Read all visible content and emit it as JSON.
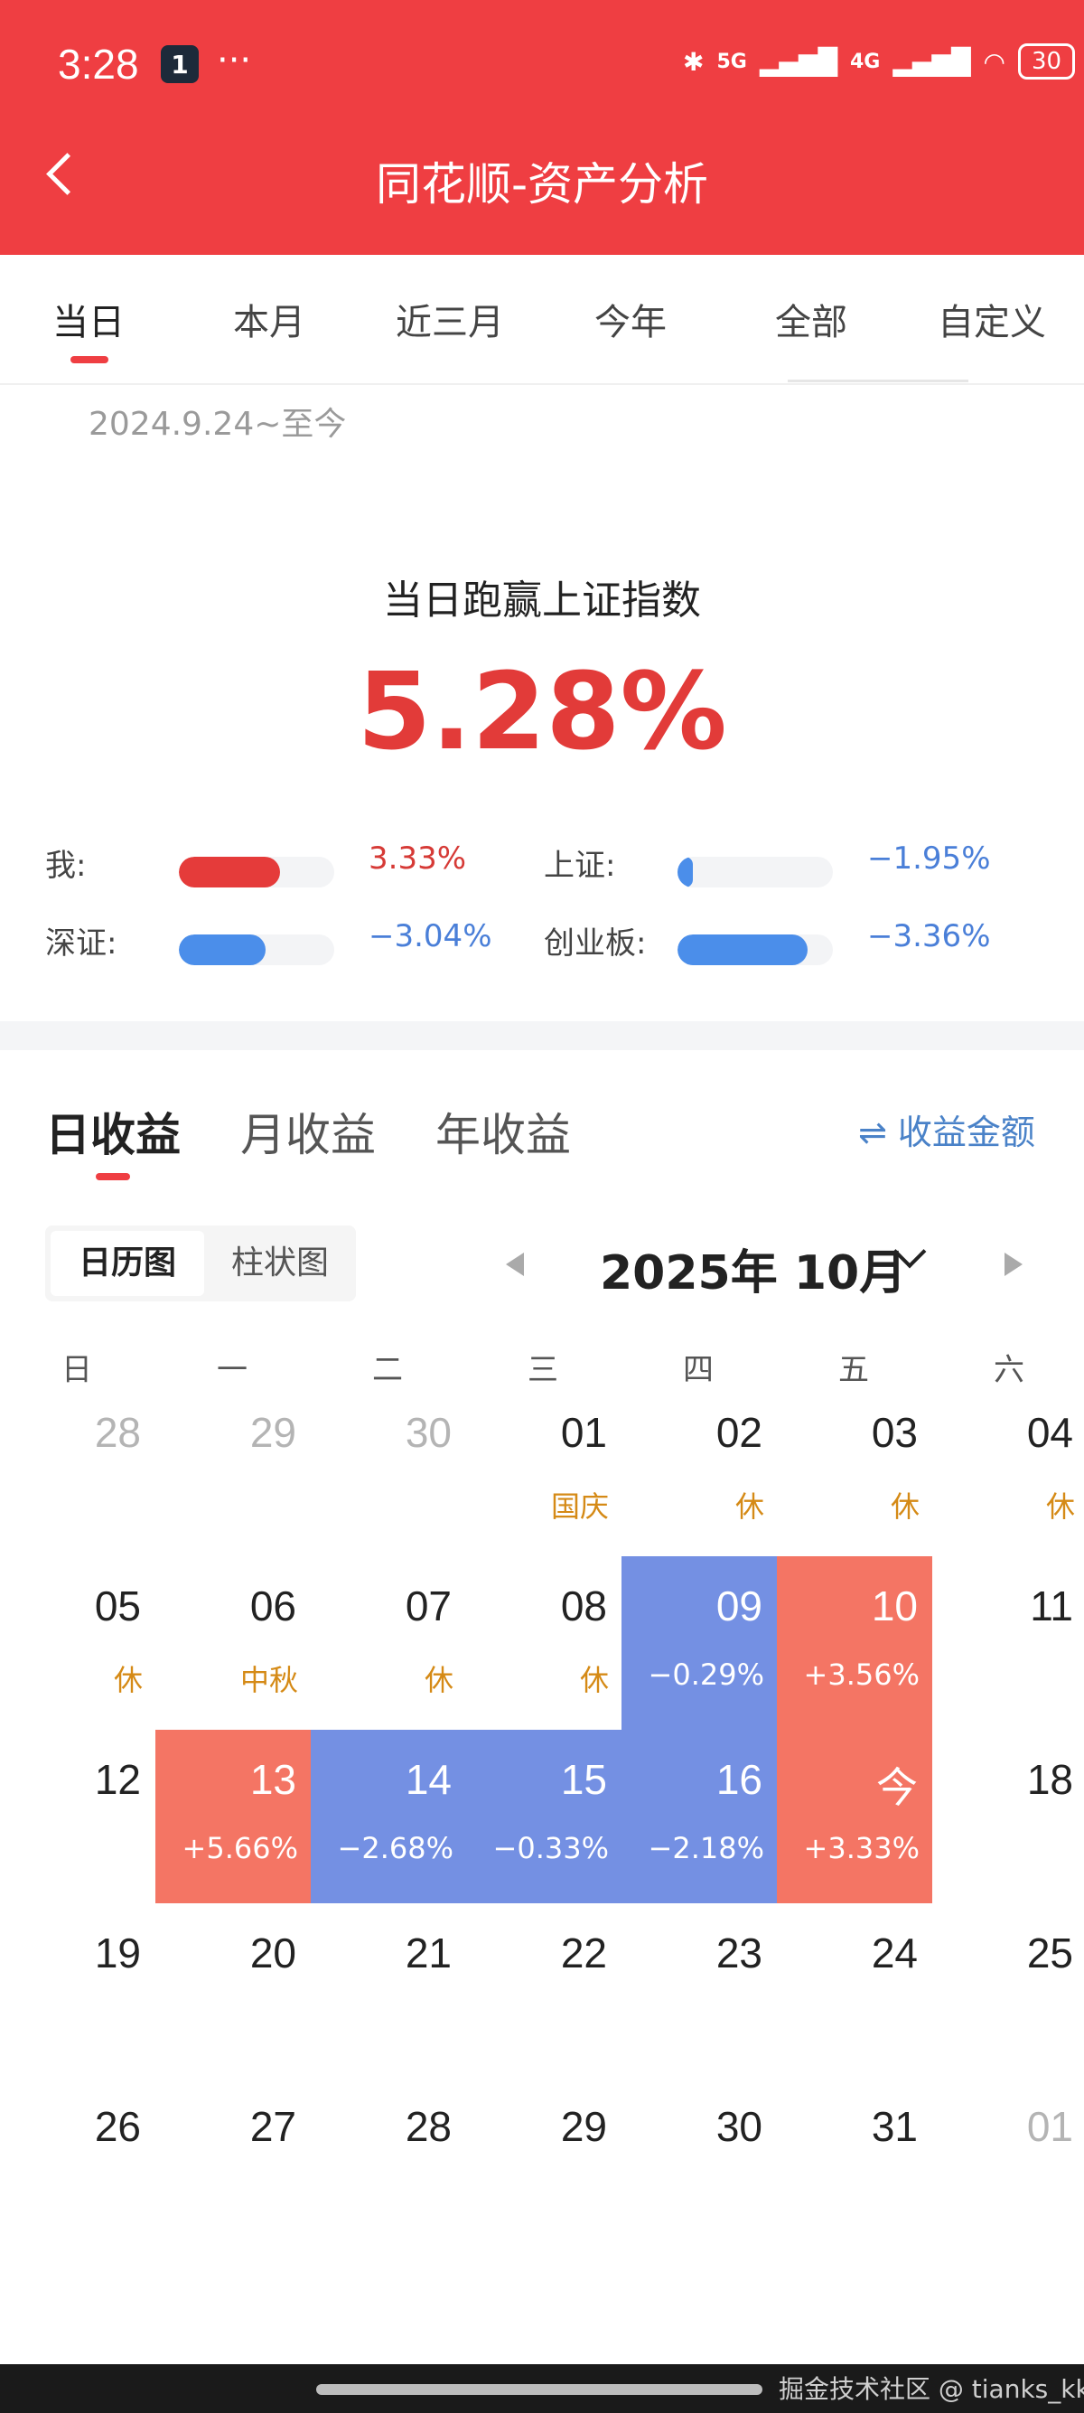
{
  "status_bar": {
    "time": "3:28",
    "app_badge": "1",
    "more": "···",
    "net1": "5G",
    "net2": "4G",
    "battery": "30"
  },
  "nav": {
    "title": "同花顺-资产分析"
  },
  "period_tabs": [
    "当日",
    "本月",
    "近三月",
    "今年",
    "全部",
    "自定义"
  ],
  "date_range": "2024.9.24~至今",
  "summary": {
    "headline": "当日跑赢上证指数",
    "value": "5.28%"
  },
  "comparisons": [
    {
      "label": "我:",
      "value": "3.33%",
      "fraction": 0.65,
      "color": "#e53b3a"
    },
    {
      "label": "上证:",
      "value": "−1.95%",
      "fraction": 0.08,
      "color": "#4b8eea"
    },
    {
      "label": "深证:",
      "value": "−3.04%",
      "fraction": 0.56,
      "color": "#4b8eea"
    },
    {
      "label": "创业板:",
      "value": "−3.36%",
      "fraction": 0.84,
      "color": "#4b8eea"
    }
  ],
  "return_tabs": [
    "日收益",
    "月收益",
    "年收益"
  ],
  "toggle_amount": "⇌ 收益金额",
  "view_toggle": {
    "calendar": "日历图",
    "bar": "柱状图"
  },
  "month": {
    "label": "2025年 10月"
  },
  "weekdays": [
    "日",
    "一",
    "二",
    "三",
    "四",
    "五",
    "六"
  ],
  "colors": {
    "up": "#f47564",
    "down": "#7490e3",
    "holiday": "#d58a16"
  },
  "calendar": [
    [
      {
        "d": "28",
        "muted": true
      },
      {
        "d": "29",
        "muted": true
      },
      {
        "d": "30",
        "muted": true
      },
      {
        "d": "01",
        "sub": "国庆",
        "kind": "hol"
      },
      {
        "d": "02",
        "sub": "休",
        "kind": "hol"
      },
      {
        "d": "03",
        "sub": "休",
        "kind": "hol"
      },
      {
        "d": "04",
        "sub": "休",
        "kind": "hol"
      }
    ],
    [
      {
        "d": "05",
        "sub": "休",
        "kind": "hol"
      },
      {
        "d": "06",
        "sub": "中秋",
        "kind": "hol"
      },
      {
        "d": "07",
        "sub": "休",
        "kind": "hol"
      },
      {
        "d": "08",
        "sub": "休",
        "kind": "hol"
      },
      {
        "d": "09",
        "sub": "−0.29%",
        "kind": "down"
      },
      {
        "d": "10",
        "sub": "+3.56%",
        "kind": "up"
      },
      {
        "d": "11"
      }
    ],
    [
      {
        "d": "12"
      },
      {
        "d": "13",
        "sub": "+5.66%",
        "kind": "up"
      },
      {
        "d": "14",
        "sub": "−2.68%",
        "kind": "down"
      },
      {
        "d": "15",
        "sub": "−0.33%",
        "kind": "down"
      },
      {
        "d": "16",
        "sub": "−2.18%",
        "kind": "down"
      },
      {
        "d": "今",
        "sub": "+3.33%",
        "kind": "up"
      },
      {
        "d": "18"
      }
    ],
    [
      {
        "d": "19"
      },
      {
        "d": "20"
      },
      {
        "d": "21"
      },
      {
        "d": "22"
      },
      {
        "d": "23"
      },
      {
        "d": "24"
      },
      {
        "d": "25"
      }
    ],
    [
      {
        "d": "26"
      },
      {
        "d": "27"
      },
      {
        "d": "28"
      },
      {
        "d": "29"
      },
      {
        "d": "30"
      },
      {
        "d": "31"
      },
      {
        "d": "01",
        "muted": true
      }
    ]
  ],
  "watermark": "掘金技术社区 @ tianks_kk"
}
